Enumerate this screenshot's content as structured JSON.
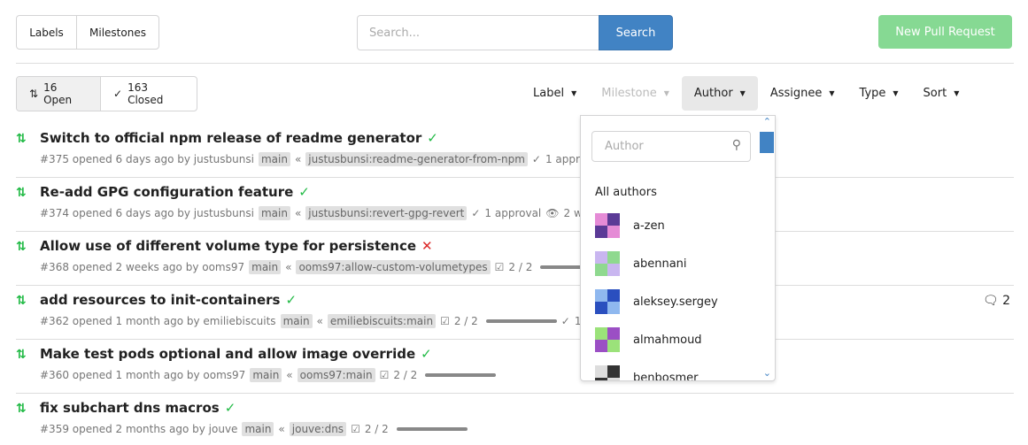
{
  "toolbar": {
    "labels": "Labels",
    "milestones": "Milestones",
    "search_placeholder": "Search...",
    "search_button": "Search",
    "new_pr": "New Pull Request"
  },
  "state_tabs": {
    "open": "16 Open",
    "closed": "163 Closed"
  },
  "filters": {
    "label": "Label",
    "milestone": "Milestone",
    "author": "Author",
    "assignee": "Assignee",
    "type": "Type",
    "sort": "Sort"
  },
  "author_dropdown": {
    "placeholder": "Author",
    "all": "All authors",
    "authors": [
      {
        "name": "a-zen",
        "colors": [
          "#5b3a96",
          "#e58bd6"
        ]
      },
      {
        "name": "abennani",
        "colors": [
          "#8fd98f",
          "#c9b6f0"
        ]
      },
      {
        "name": "aleksey.sergey",
        "colors": [
          "#2a4fbf",
          "#8fb8ef"
        ]
      },
      {
        "name": "almahmoud",
        "colors": [
          "#9b4fc4",
          "#9be27a"
        ]
      },
      {
        "name": "benbosmer",
        "colors": [
          "#333",
          "#ddd"
        ]
      }
    ]
  },
  "pulls": [
    {
      "title": "Switch to official npm release of readme generator",
      "status": "success",
      "meta": "#375 opened 6 days ago by justusbunsi",
      "base": "main",
      "head": "justusbunsi:readme-generator-from-npm",
      "approval": "1 approval"
    },
    {
      "title": "Re-add GPG configuration feature",
      "status": "success",
      "meta": "#374 opened 6 days ago by justusbunsi",
      "base": "main",
      "head": "justusbunsi:revert-gpg-revert",
      "approval": "1 approval",
      "waiting": "2 wait"
    },
    {
      "title": "Allow use of different volume type for persistence",
      "status": "failure",
      "meta": "#368 opened 2 weeks ago by ooms97",
      "base": "main",
      "head": "ooms97:allow-custom-volumetypes",
      "tasks": "2 / 2"
    },
    {
      "title": "add resources to init-containers",
      "status": "success",
      "meta": "#362 opened 1 month ago by emiliebiscuits",
      "base": "main",
      "head": "emiliebiscuits:main",
      "tasks": "2 / 2",
      "approval": "1 ap",
      "comments": "2"
    },
    {
      "title": "Make test pods optional and allow image override",
      "status": "success",
      "meta": "#360 opened 1 month ago by ooms97",
      "base": "main",
      "head": "ooms97:main",
      "tasks": "2 / 2"
    },
    {
      "title": "fix subchart dns macros",
      "status": "success",
      "meta": "#359 opened 2 months ago by jouve",
      "base": "main",
      "head": "jouve:dns",
      "tasks": "2 / 2"
    }
  ],
  "colors": {
    "accent": "#4183c4",
    "success": "#21ba45",
    "failure": "#db2828",
    "new_pr": "#86d993"
  }
}
